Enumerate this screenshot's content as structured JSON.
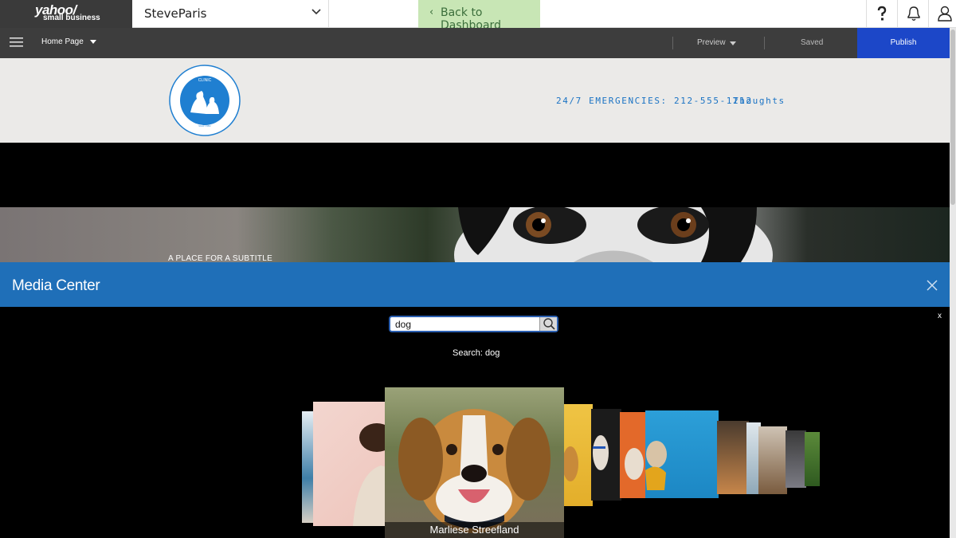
{
  "topbar": {
    "logo_line1": "yahoo/",
    "logo_line2": "small business",
    "site_name": "SteveParis",
    "back_label": "Back to Dashboard"
  },
  "editbar": {
    "page_label": "Home Page",
    "preview_label": "Preview",
    "saved_label": "Saved",
    "publish_label": "Publish"
  },
  "site": {
    "emergency": "24/7 EMERGENCIES: 212-555-1212",
    "nav_thoughts": "Thoughts",
    "hero_subtitle": "A PLACE FOR A SUBTITLE"
  },
  "media": {
    "title": "Media Center",
    "search_value": "dog",
    "search_label": "Search: dog",
    "close_small": "x",
    "selected_caption": "Marliese Streefland"
  },
  "colors": {
    "publish": "#1c47c8",
    "media_bar": "#1f6fb8",
    "back_button_bg": "#c8e6b5",
    "site_link": "#1a73c4"
  }
}
